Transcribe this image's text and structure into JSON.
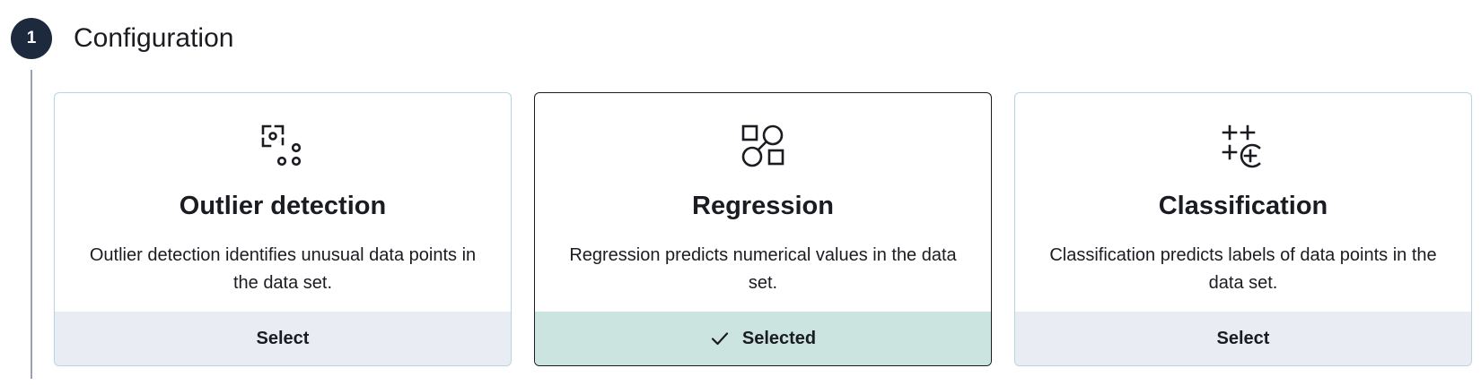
{
  "step": {
    "number": "1",
    "title": "Configuration"
  },
  "cards": [
    {
      "icon": "outlier-detection-icon",
      "title": "Outlier detection",
      "description": "Outlier detection identifies unusual data points in the data set.",
      "action": "Select",
      "selected": false
    },
    {
      "icon": "regression-icon",
      "title": "Regression",
      "description": "Regression predicts numerical values in the data set.",
      "action": "Selected",
      "selected": true
    },
    {
      "icon": "classification-icon",
      "title": "Classification",
      "description": "Classification predicts labels of data points in the data set.",
      "action": "Select",
      "selected": false
    }
  ],
  "colors": {
    "badge": "#1d2a3e",
    "card_border": "#b6d6e2",
    "footer": "#e9edf3",
    "footer_selected": "#cce4df"
  }
}
